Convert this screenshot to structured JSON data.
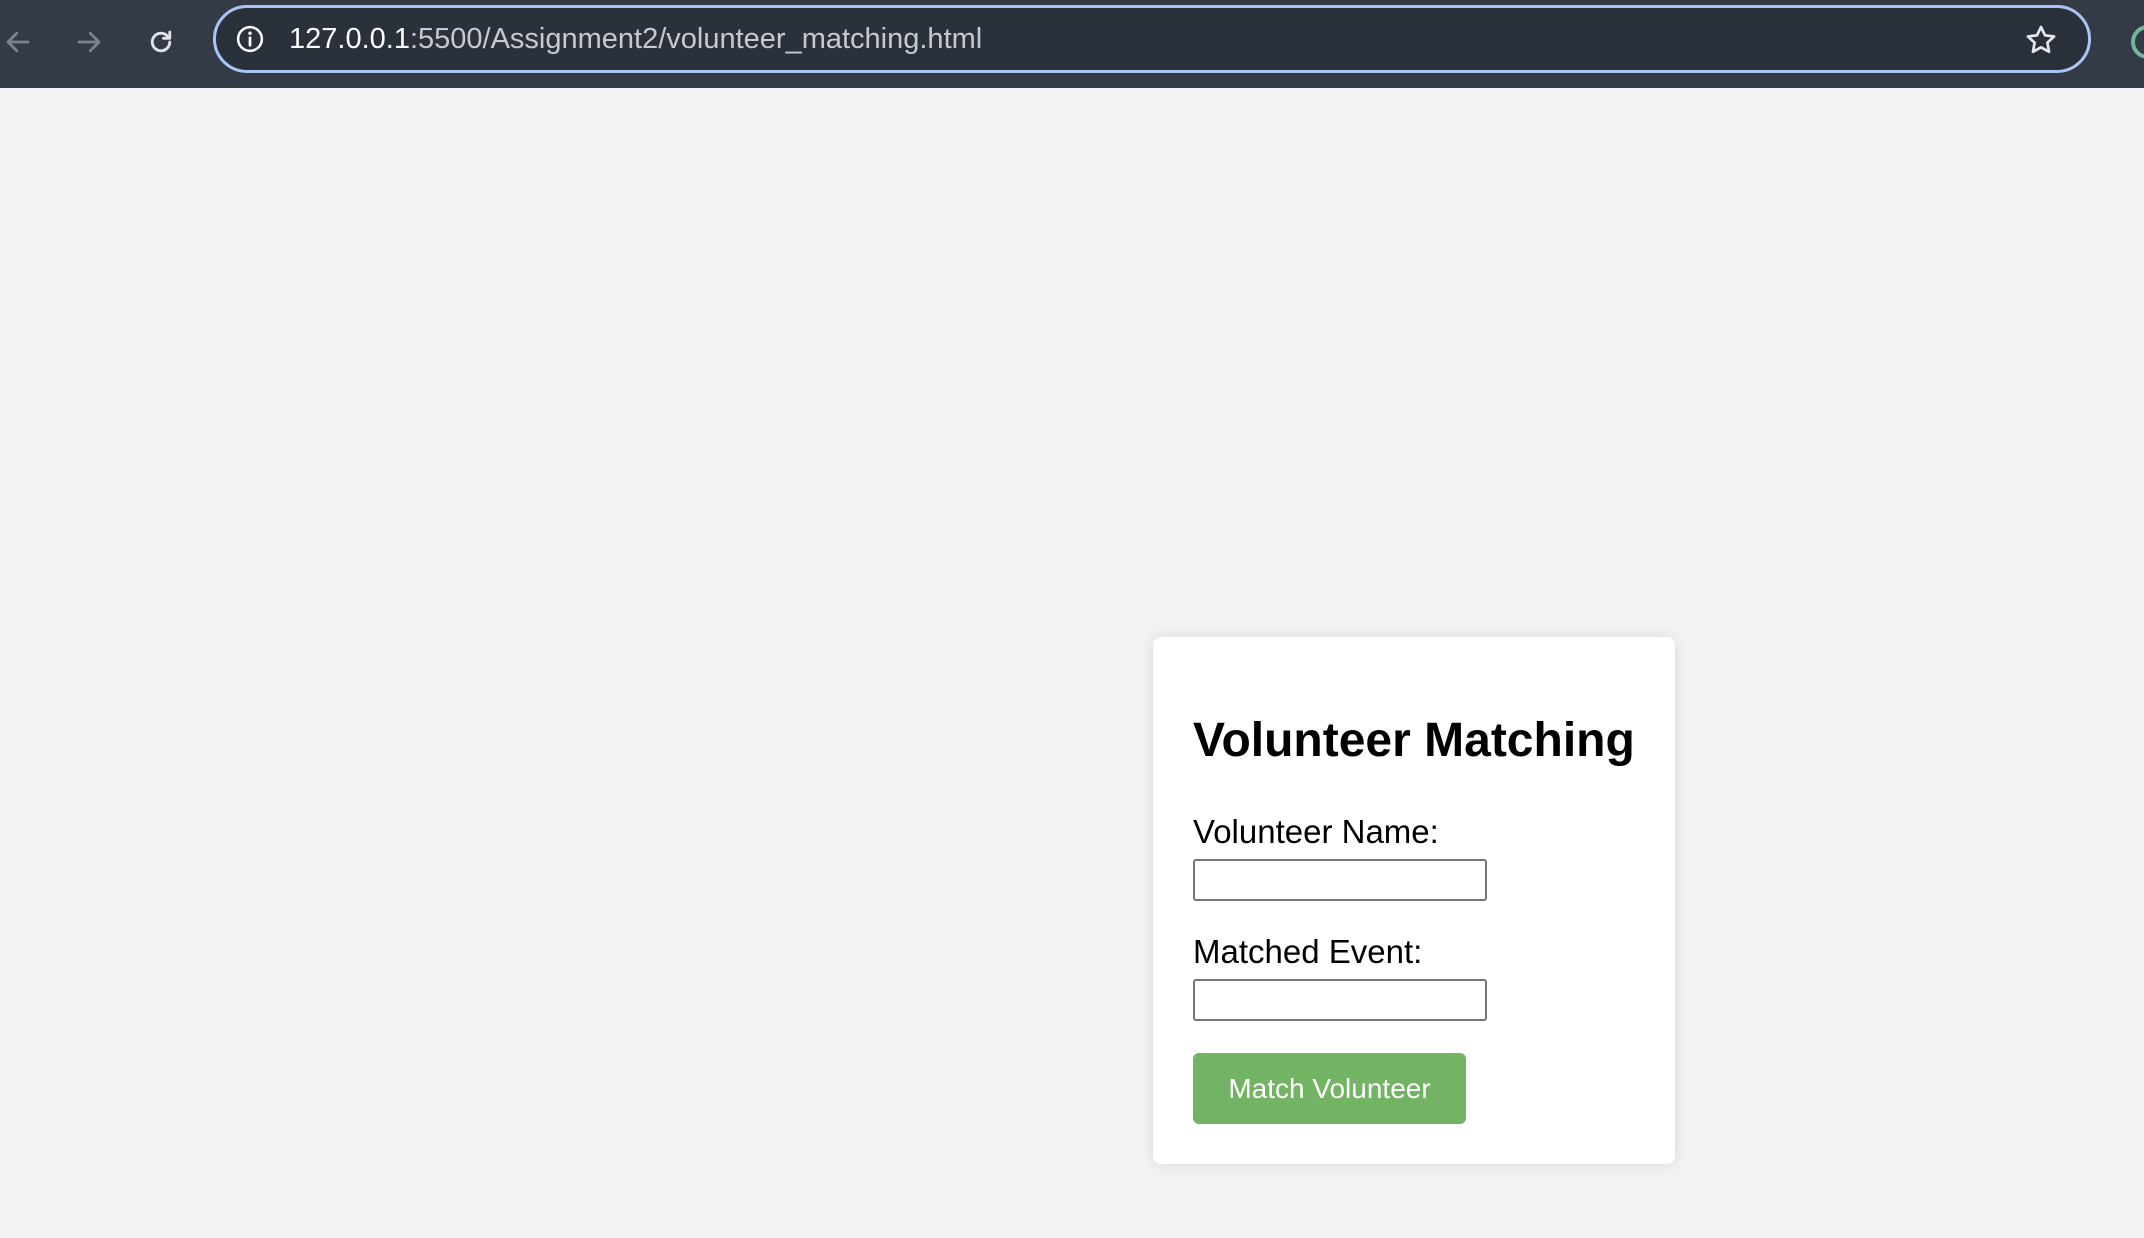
{
  "browser": {
    "url_host": "127.0.0.1",
    "url_path": ":5500/Assignment2/volunteer_matching.html",
    "toolbar_color": "#343b47",
    "focus_ring_color": "#a8c5f5"
  },
  "page": {
    "title": "Volunteer Matching",
    "volunteer_name_label": "Volunteer Name:",
    "volunteer_name_value": "",
    "matched_event_label": "Matched Event:",
    "matched_event_value": "",
    "submit_label": "Match Volunteer",
    "button_color": "#73b464",
    "background_color": "#f2f2f2"
  },
  "icons": [
    "back-arrow-icon",
    "forward-arrow-icon",
    "reload-icon",
    "site-info-icon",
    "bookmark-star-icon",
    "extension-icon"
  ]
}
